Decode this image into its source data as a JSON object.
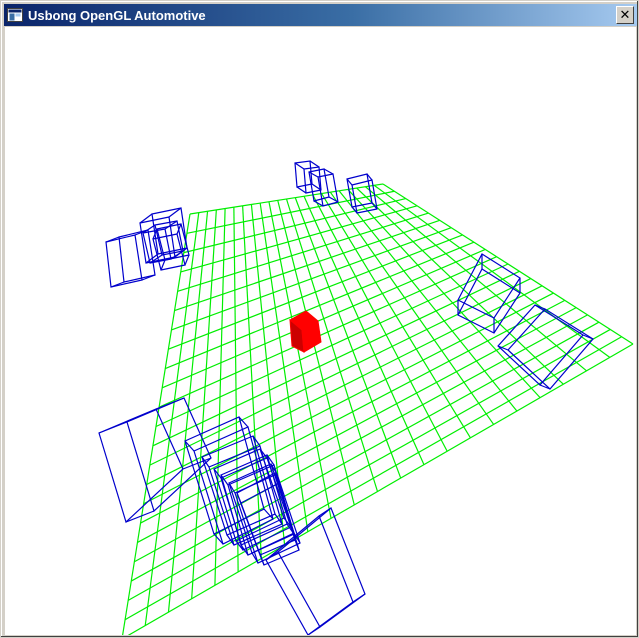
{
  "window": {
    "title": "Usbong OpenGL Automotive",
    "icon": "app-window-icon",
    "close_glyph": "✕",
    "close_icon": "close-icon"
  },
  "scene": {
    "background": "#ffffff",
    "colors": {
      "grid": "#00ee00",
      "boxes": "#0000cc",
      "player": "#ff0000",
      "player_dark": "#cc0000",
      "titlebar_start": "#0a246a",
      "titlebar_end": "#a6caf0"
    }
  }
}
